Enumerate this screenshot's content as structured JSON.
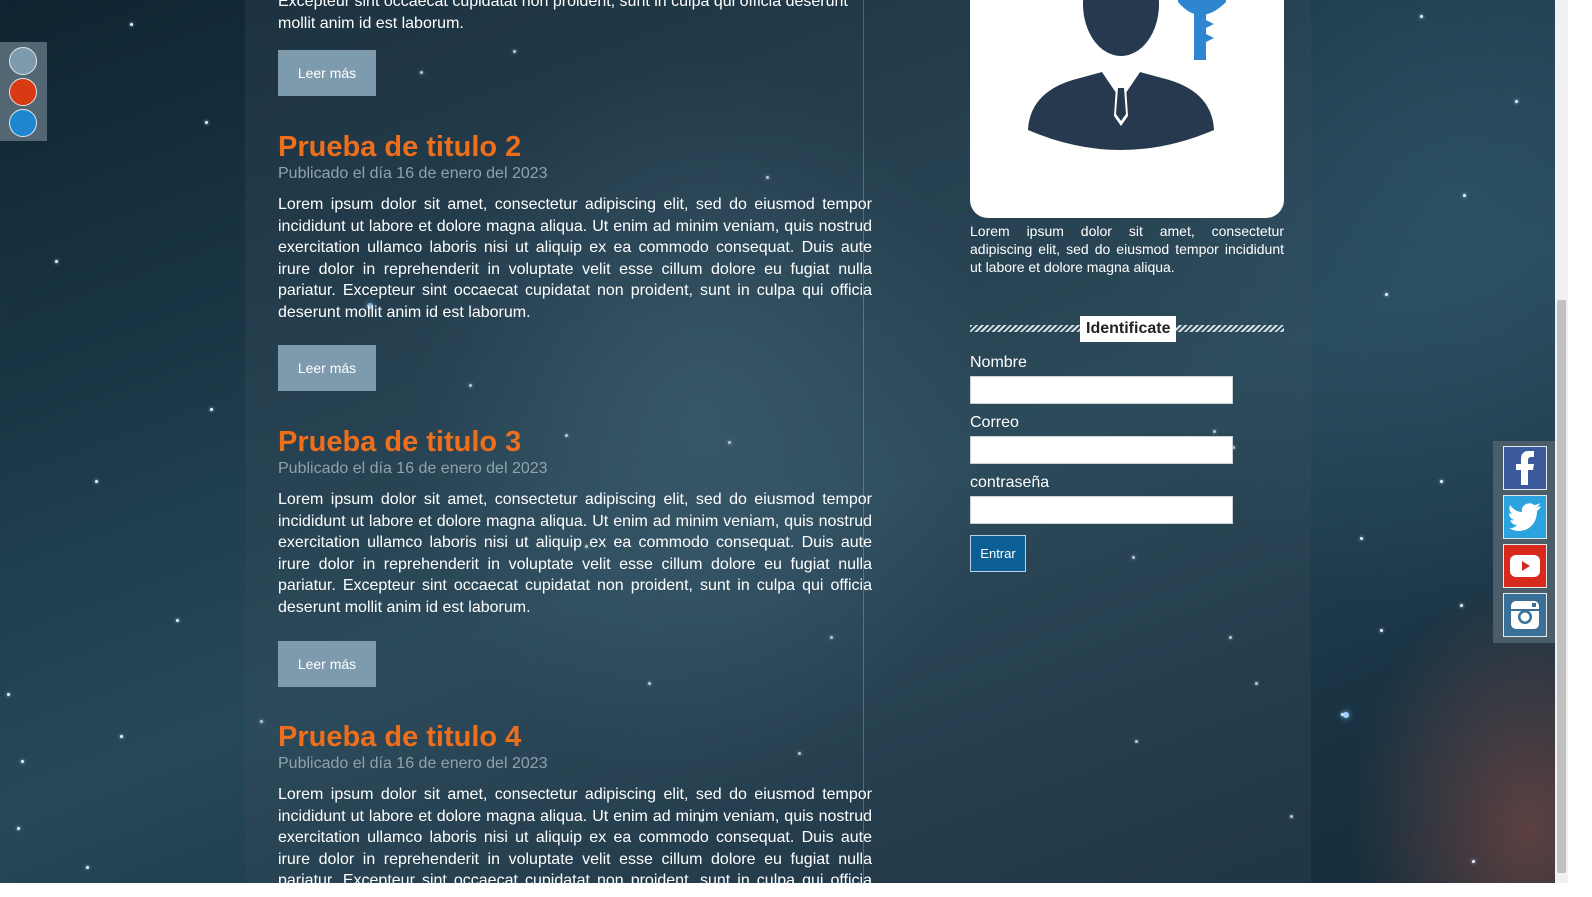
{
  "posts": {
    "body": "Lorem ipsum dolor sit amet, consectetur adipiscing elit, sed do eiusmod tempor incididunt ut labore et dolore magna aliqua. Ut enim ad minim veniam, quis nostrud exercitation ullamco laboris nisi ut aliquip ex ea commodo consequat. Duis aute irure dolor in reprehenderit in voluptate velit esse cillum dolore eu fugiat nulla pariatur. Excepteur sint occaecat cupidatat non proident, sunt in culpa qui officia deserunt mollit anim id est laborum.",
    "partial_top_line_1": "Excepteur sint occaecat cupidatat non proident, sunt in culpa qui officia deserunt",
    "partial_top_line_2": "mollit anim id est laborum.",
    "read_more_label": "Leer más",
    "items": [
      {
        "title": "Prueba de titulo 2",
        "date": "Publicado el día 16 de enero del 2023"
      },
      {
        "title": "Prueba de titulo 3",
        "date": "Publicado el día 16 de enero del 2023"
      },
      {
        "title": "Prueba de titulo 4",
        "date": "Publicado el día 16 de enero del 2023"
      }
    ]
  },
  "sidebar": {
    "description": "Lorem ipsum dolor sit amet, consectetur adipiscing elit, sed do eiusmod tempor incididunt ut labore et dolore magna aliqua.",
    "login": {
      "heading": "Identificate",
      "fields": [
        {
          "label": "Nombre",
          "value": ""
        },
        {
          "label": "Correo",
          "value": ""
        },
        {
          "label": "contraseña",
          "value": ""
        }
      ],
      "submit_label": "Entrar"
    }
  },
  "theme_switcher": {
    "swatches": [
      "#7e9bad",
      "#d83a14",
      "#1e86cf"
    ]
  },
  "social": {
    "items": [
      {
        "icon": "facebook-icon",
        "color": "#3b5a9b"
      },
      {
        "icon": "twitter-icon",
        "color": "#2aa3de"
      },
      {
        "icon": "youtube-icon",
        "color": "#d8291f"
      },
      {
        "icon": "instagram-icon",
        "color": "#3a6f97"
      }
    ]
  },
  "colors": {
    "accent": "#ee6f1b",
    "button": "#7e9bad",
    "submit": "#0c5f95"
  }
}
